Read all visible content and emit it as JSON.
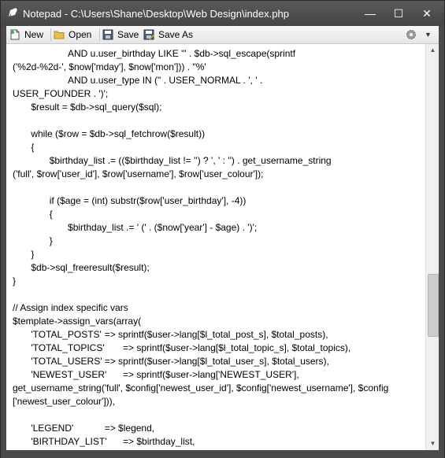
{
  "window": {
    "title": "Notepad - C:\\Users\\Shane\\Desktop\\Web Design\\index.php",
    "minimize_glyph": "—",
    "maximize_glyph": "☐",
    "close_glyph": "✕"
  },
  "toolbar": {
    "new_label": "New",
    "open_label": "Open",
    "save_label": "Save",
    "save_as_label": "Save As",
    "settings_icon": "gear-icon",
    "dropdown_glyph": "▼"
  },
  "editor": {
    "lines": [
      "\t\t\tAND u.user_birthday LIKE '\" . $db->sql_escape(sprintf",
      "('%2d-%2d-', $now['mday'], $now['mon'])) . \"%'",
      "\t\t\tAND u.user_type IN (\" . USER_NORMAL . ', ' .",
      "USER_FOUNDER . ')';",
      "\t$result = $db->sql_query($sql);",
      "",
      "\twhile ($row = $db->sql_fetchrow($result))",
      "\t{",
      "\t\t$birthday_list .= (($birthday_list != '') ? ', ' : '') . get_username_string",
      "('full', $row['user_id'], $row['username'], $row['user_colour']);",
      "",
      "\t\tif ($age = (int) substr($row['user_birthday'], -4))",
      "\t\t{",
      "\t\t\t$birthday_list .= ' (' . ($now['year'] - $age) . ')';",
      "\t\t}",
      "\t}",
      "\t$db->sql_freeresult($result);",
      "}",
      "",
      "// Assign index specific vars",
      "$template->assign_vars(array(",
      "\t'TOTAL_POSTS'\t=> sprintf($user->lang[$l_total_post_s], $total_posts),",
      "\t'TOTAL_TOPICS'\t=> sprintf($user->lang[$l_total_topic_s], $total_topics),",
      "\t'TOTAL_USERS'\t=> sprintf($user->lang[$l_total_user_s], $total_users),",
      "\t'NEWEST_USER'\t=> sprintf($user->lang['NEWEST_USER'],",
      "get_username_string('full', $config['newest_user_id'], $config['newest_username'], $config",
      "['newest_user_colour'])),",
      "",
      "\t'LEGEND'\t\t=> $legend,",
      "\t'BIRTHDAY_LIST'\t=> $birthday_list,"
    ]
  },
  "scrollbar": {
    "up_glyph": "▲",
    "down_glyph": "▼",
    "position_fraction": 0.68
  }
}
